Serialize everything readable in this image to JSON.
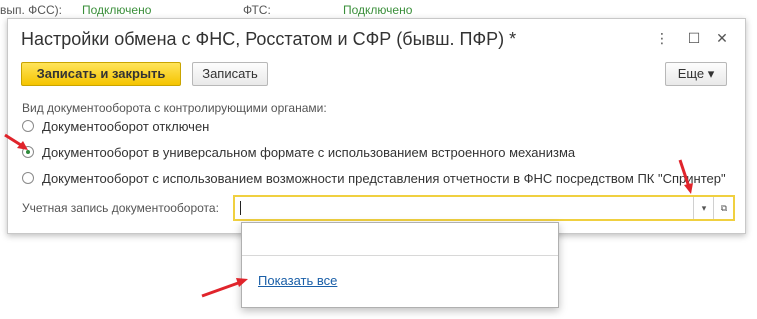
{
  "background": {
    "items": [
      {
        "text": "вып. ФСС):"
      },
      {
        "text": "Подключено"
      },
      {
        "text": "ФТС:"
      },
      {
        "text": "Подключено"
      }
    ]
  },
  "dialog": {
    "title": "Настройки обмена с ФНС, Росстатом и СФР (бывш. ПФР) *",
    "controls": {
      "more": "⋮",
      "maximize": "☐",
      "close": "✕"
    },
    "toolbar": {
      "save_close": "Записать и закрыть",
      "save": "Записать",
      "more": "Еще ▾"
    },
    "doc_flow": {
      "label": "Вид документооборота с контролирующими органами:",
      "options": [
        {
          "label": "Документооборот отключен",
          "selected": false
        },
        {
          "label": "Документооборот в универсальном формате с использованием встроенного механизма",
          "selected": true
        },
        {
          "label": "Документооборот с использованием возможности представления отчетности в ФНС посредством ПК \"Спринтер\"",
          "selected": false
        }
      ]
    },
    "account": {
      "label": "Учетная запись документооборота:",
      "value": "",
      "dropdown_icon": "▾",
      "open_icon": "⧉"
    }
  },
  "dropdown": {
    "show_all": "Показать все"
  },
  "colors": {
    "primary_button": "#f5c400",
    "field_border": "#f0d040",
    "link": "#1a5fa8",
    "arrow": "#e0242b",
    "connected": "#3a8f3a"
  }
}
